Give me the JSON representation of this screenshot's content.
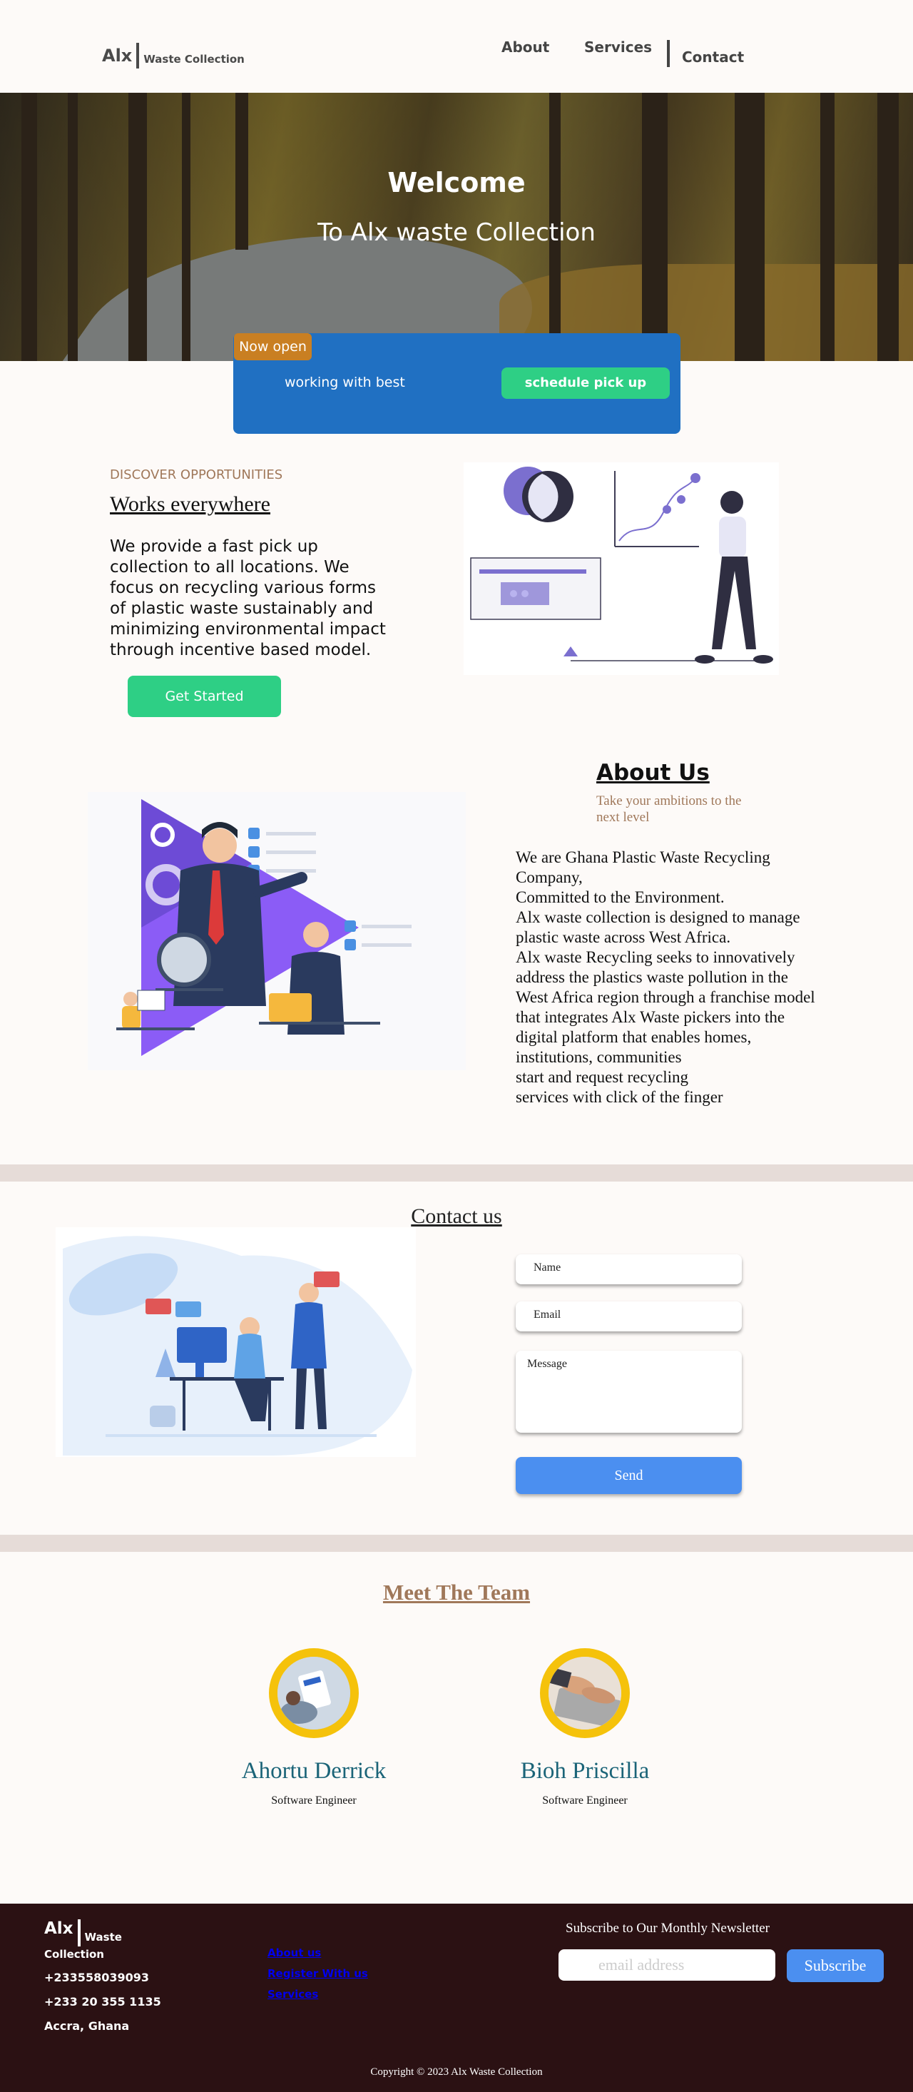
{
  "header": {
    "brand": "Alx",
    "brand_sub": "Waste Collection",
    "nav": {
      "about": "About",
      "services": "Services",
      "contact": "Contact"
    }
  },
  "hero": {
    "title": "Welcome",
    "subtitle": "To Alx waste Collection"
  },
  "promo": {
    "badge": "Now open",
    "tagline": "working with best",
    "schedule_label": "schedule pick up"
  },
  "works": {
    "kicker": "DISCOVER OPPORTUNITIES",
    "title": "Works everywhere",
    "text": "We provide a fast pick up collection to all locations. We focus on recycling various forms of plastic waste sustainably and minimizing environmental impact through incentive based model.",
    "cta": "Get Started"
  },
  "about": {
    "title": "About Us",
    "subtitle": "Take your ambitions to the next level",
    "lines": [
      "We are Ghana Plastic Waste Recycling Company,",
      "Committed to the Environment.",
      "Alx waste collection is designed to manage plastic waste across West Africa.",
      "Alx waste Recycling seeks to innovatively address the plastics waste pollution in the West Africa region through a franchise model that integrates Alx Waste pickers into the digital platform that enables homes, institutions, communities",
      "start and request recycling",
      "services with click of the finger"
    ]
  },
  "contact": {
    "title": "Contact us",
    "name_placeholder": "Name",
    "email_placeholder": "Email",
    "message_placeholder": "Message",
    "send_label": "Send"
  },
  "team": {
    "title": "Meet The Team",
    "members": [
      {
        "name": "Ahortu Derrick",
        "role": "Software Engineer"
      },
      {
        "name": "Bioh Priscilla",
        "role": "Software Engineer"
      }
    ]
  },
  "footer": {
    "brand": "Alx",
    "brand_sub1": "Waste",
    "brand_sub2": "Collection",
    "phone1": "+233558039093",
    "phone2": "+233 20 355 1135",
    "location": "Accra, Ghana",
    "links": [
      "About us",
      "Register With us",
      "Services"
    ],
    "newsletter_title": "Subscribe to Our Monthly Newsletter",
    "newsletter_placeholder": "email address",
    "subscribe_label": "Subscribe",
    "copyright": "Copyright © 2023 Alx Waste Collection"
  },
  "colors": {
    "primary_blue": "#2070c2",
    "accent_green": "#2ecf85",
    "badge_orange": "#c97f22",
    "footer_bg": "#2b1113",
    "team_name": "#1b6478",
    "kicker_brown": "#a0785a"
  }
}
